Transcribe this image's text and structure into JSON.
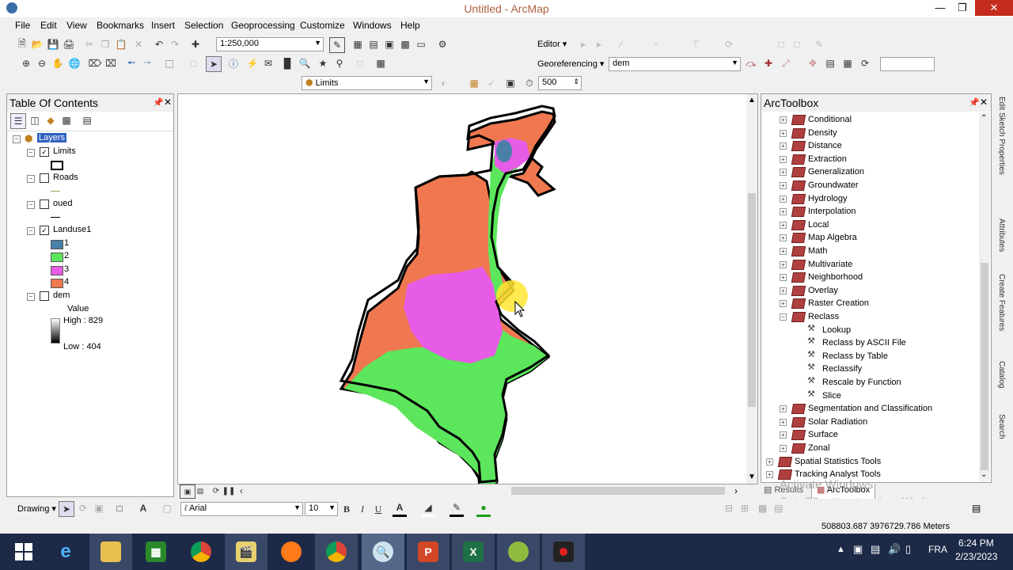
{
  "window": {
    "title": "Untitled - ArcMap"
  },
  "menu": [
    "File",
    "Edit",
    "View",
    "Bookmarks",
    "Insert",
    "Selection",
    "Geoprocessing",
    "Customize",
    "Windows",
    "Help"
  ],
  "toolbar": {
    "scale": "1:250,000",
    "editor_label": "Editor",
    "georef_label": "Georeferencing",
    "georef_layer": "dem",
    "target_layer": "Limits",
    "tolerance": "500"
  },
  "toc": {
    "title": "Table Of Contents",
    "root": "Layers",
    "layers": [
      {
        "name": "Limits",
        "checked": true
      },
      {
        "name": "Roads",
        "checked": false
      },
      {
        "name": "oued",
        "checked": false
      },
      {
        "name": "Landuse1",
        "checked": true,
        "classes": [
          {
            "label": "1",
            "color": "#4a7fa8"
          },
          {
            "label": "2",
            "color": "#5ce65c"
          },
          {
            "label": "3",
            "color": "#e65ce6"
          },
          {
            "label": "4",
            "color": "#f07850"
          }
        ]
      },
      {
        "name": "dem",
        "checked": false,
        "value_label": "Value",
        "high": "High : 829",
        "low": "Low : 404"
      }
    ]
  },
  "toolbox": {
    "title": "ArcToolbox",
    "items": [
      "Conditional",
      "Density",
      "Distance",
      "Extraction",
      "Generalization",
      "Groundwater",
      "Hydrology",
      "Interpolation",
      "Local",
      "Map Algebra",
      "Math",
      "Multivariate",
      "Neighborhood",
      "Overlay",
      "Raster Creation",
      "Reclass"
    ],
    "reclass_tools": [
      "Lookup",
      "Reclass by ASCII File",
      "Reclass by Table",
      "Reclassify",
      "Rescale by Function",
      "Slice"
    ],
    "after_items": [
      "Segmentation and Classification",
      "Solar Radiation",
      "Surface",
      "Zonal"
    ],
    "toolboxes": [
      "Spatial Statistics Tools",
      "Tracking Analyst Tools"
    ],
    "tabs": [
      "Results",
      "ArcToolbox"
    ]
  },
  "side_tabs": [
    "Edit Sketch Properties",
    "Attributes",
    "Create Features",
    "Catalog",
    "Search"
  ],
  "drawing": {
    "label": "Drawing",
    "font": "Arial",
    "size": "10",
    "bold": "B",
    "italic": "I",
    "underline": "U",
    "font_color_glyph": "A"
  },
  "status": {
    "coords": "508803.687  3976729.786 Meters"
  },
  "watermark": {
    "line1": "Activate Windows",
    "line2": "Go to PC settings to activate Windows."
  },
  "taskbar": {
    "lang": "FRA",
    "time": "6:24 PM",
    "date": "2/23/2023",
    "word_icon": "e",
    "excel_icon": "X",
    "powerpoint_icon": "P"
  }
}
